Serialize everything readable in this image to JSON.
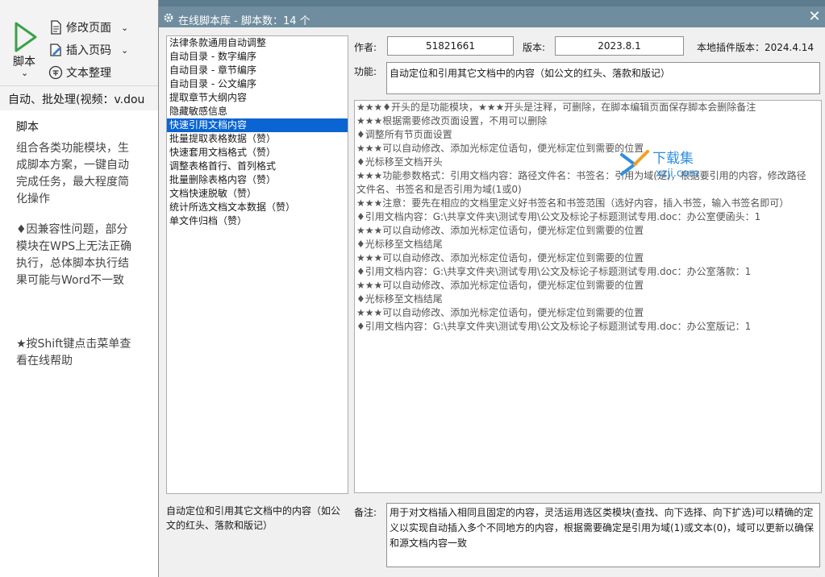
{
  "ribbon": {
    "run_label": "脚本",
    "run_caret": "⌄",
    "edit_page": "修改页面",
    "insert_page_number": "插入页码",
    "text_tidy": "文本整理",
    "caret": "⌄"
  },
  "hint_text": "自动、批处理(视频：v.dou",
  "side_panel": {
    "title": "脚本",
    "p1": "组合各类功能模块，生成脚本方案，一键自动完成任务，最大程度简化操作",
    "p2": "♦因兼容性问题，部分模块在WPS上无法正确执行，总体脚本执行结果可能与Word不一致",
    "p3": "★按Shift键点击菜单查看在线帮助"
  },
  "dialog": {
    "title": "在线脚本库 - 脚本数：14 个",
    "close": "✕",
    "author_label": "作者:",
    "author": "51821661",
    "version_label": "版本:",
    "version": "2023.8.1",
    "plugin_version": "本地插件版本：2024.4.14",
    "function_label": "功能:",
    "function": "自动定位和引用其它文档中的内容（如公文的红头、落款和版记）",
    "remark_label": "备注:",
    "remark": "用于对文档插入相同且固定的内容，灵活运用选区类模块(查找、向下选择、向下扩选)可以精确的定义以实现自动插入多个不同地方的内容，根据需要确定是引用为域(1)或文本(0)，域可以更新以确保和源文档内容一致",
    "bottom_desc": "自动定位和引用其它文档中的内容（如公文的红头、落款和版记）"
  },
  "scripts": [
    {
      "label": "法律条款通用自动调整",
      "selected": false
    },
    {
      "label": "自动目录 - 数字编序",
      "selected": false
    },
    {
      "label": "自动目录 - 章节编序",
      "selected": false
    },
    {
      "label": "自动目录 - 公文编序",
      "selected": false
    },
    {
      "label": "提取章节大纲内容",
      "selected": false
    },
    {
      "label": "隐藏敏感信息",
      "selected": false
    },
    {
      "label": "快速引用文档内容",
      "selected": true
    },
    {
      "label": "批量提取表格数据（赞）",
      "selected": false
    },
    {
      "label": "快速套用文档格式（赞）",
      "selected": false
    },
    {
      "label": "调整表格首行、首列格式",
      "selected": false
    },
    {
      "label": "批量删除表格内容（赞）",
      "selected": false
    },
    {
      "label": "文档快速脱敏（赞）",
      "selected": false
    },
    {
      "label": "统计所选文档文本数据（赞）",
      "selected": false
    },
    {
      "label": "单文件归档（赞）",
      "selected": false
    }
  ],
  "details": [
    "★★★♦开头的是功能模块，★★★开头是注释，可删除，在脚本编辑页面保存脚本会删除备注",
    "★★★根据需要修改页面设置，不用可以删除",
    "♦调整所有节页面设置",
    "★★★可以自动修改、添加光标定位语句，便光标定位到需要的位置",
    "♦光标移至文档开头",
    "★★★功能参数格式：引用文档内容：路径文件名：书签名：引用为域(是)，根据要引用的内容，修改路径",
    "文件名、书签名和是否引用为域(1或0)",
    "★★★注意：要先在相应的文档里定义好书签名和书签范围（选好内容，插入书签，输入书签名即可）",
    "♦引用文档内容：G:\\共享文件夹\\测试专用\\公文及标论子标题测试专用.doc：办公室便函头：1",
    "★★★可以自动修改、添加光标定位语句，便光标定位到需要的位置",
    "♦光标移至文档结尾",
    "★★★可以自动修改、添加光标定位语句，便光标定位到需要的位置",
    "♦引用文档内容：G:\\共享文件夹\\测试专用\\公文及标论子标题测试专用.doc：办公室落款：1",
    "★★★可以自动修改、添加光标定位语句，便光标定位到需要的位置",
    "♦光标移至文档结尾",
    "★★★可以自动修改、添加光标定位语句，便光标定位到需要的位置",
    "♦引用文档内容：G:\\共享文件夹\\测试专用\\公文及标论子标题测试专用.doc：办公室版记：1"
  ],
  "watermark": {
    "big": "下载集",
    "small": "xzji.com"
  },
  "colors": {
    "titlebar": "#6f8d9f",
    "selection": "#0a64d2",
    "run_icon": "#3aa14a"
  },
  "icons": {
    "run": "play-triangle-icon",
    "edit_page": "document-icon",
    "insert_page_number": "pencil-page-icon",
    "text_tidy": "circle-text-icon",
    "dialog": "gear-icon",
    "close": "close-icon"
  }
}
